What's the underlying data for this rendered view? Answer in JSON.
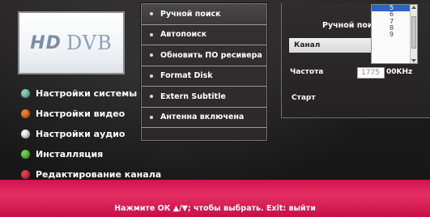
{
  "logo": {
    "hd": "HD",
    "dvb": "DVB"
  },
  "left_menu": [
    {
      "label": "Настройки системы",
      "color": "#7dd3b0",
      "icon": "teal-dot-icon"
    },
    {
      "label": "Настройки видео",
      "color": "#f07a2a",
      "icon": "orange-dot-icon"
    },
    {
      "label": "Настройки аудио",
      "color": "#f2f2f2",
      "icon": "white-dot-icon"
    },
    {
      "label": "Инсталляция",
      "color": "#6ccf4a",
      "icon": "green-dot-icon"
    },
    {
      "label": "Редактирование канала",
      "color": "#e63a4a",
      "icon": "red-dot-icon"
    }
  ],
  "submenu": [
    "Ручной поиск",
    "Автопоиск",
    "Обновить ПО ресивера",
    "Format Disk",
    "Extern Subtitle",
    "Антенна включена"
  ],
  "panel": {
    "title": "Ручной поиск",
    "channel_label": "Канал",
    "frequency_label": "Частота",
    "frequency_value": "1775",
    "frequency_unit": "00KHz",
    "start_label": "Старт"
  },
  "dropdown": {
    "options": [
      "5",
      "6",
      "7",
      "8",
      "9"
    ],
    "selected": "5"
  },
  "footer": {
    "hint": "Нажмите ОК ▲/▼; чтобы выбрать. Exit: выйти"
  },
  "colors": {
    "footer_bar": "#d1124d",
    "dropdown_selected": "#2e63c7"
  }
}
